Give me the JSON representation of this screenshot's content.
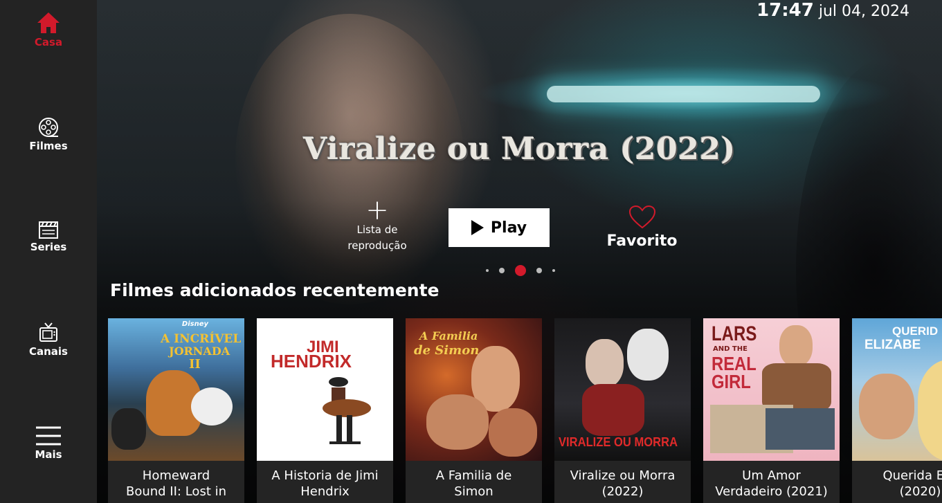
{
  "sidebar": {
    "items": [
      {
        "label": "Casa",
        "icon": "home-icon",
        "active": true
      },
      {
        "label": "Filmes",
        "icon": "film-reel-icon"
      },
      {
        "label": "Series",
        "icon": "clapperboard-icon"
      },
      {
        "label": "Canais",
        "icon": "tv-icon"
      },
      {
        "label": "Mais",
        "icon": "menu-icon"
      }
    ],
    "accent_color": "#d21a2b"
  },
  "header": {
    "time": "17:47",
    "date": "jul 04, 2024"
  },
  "hero": {
    "title": "Viralize ou Morra (2022)",
    "add_label_line1": "Lista de",
    "add_label_line2": "reprodução",
    "play_label": "Play",
    "favorite_label": "Favorito",
    "carousel": {
      "total": 5,
      "active_index": 2
    }
  },
  "section": {
    "title": "Filmes adicionados recentemente"
  },
  "movies": [
    {
      "caption_line1": "Homeward",
      "caption_line2": "Bound II: Lost in",
      "poster_text1": "Disney",
      "poster_text2": "A INCRÍVEL",
      "poster_text3": "JORNADA",
      "poster_text4": "II"
    },
    {
      "caption_line1": "A Historia de Jimi",
      "caption_line2": "Hendrix",
      "poster_text1": "JIMI",
      "poster_text2": "HENDRIX"
    },
    {
      "caption_line1": "A Familia de",
      "caption_line2": "Simon",
      "poster_text1": "A Familia",
      "poster_text2": "de Simon"
    },
    {
      "caption_line1": "Viralize ou Morra",
      "caption_line2": "(2022)",
      "poster_text1": "VIRALIZE OU MORRA"
    },
    {
      "caption_line1": "Um Amor",
      "caption_line2": "Verdadeiro (2021)",
      "poster_text1": "LARS",
      "poster_text2": "AND THE",
      "poster_text3": "REAL",
      "poster_text4": "GIRL"
    },
    {
      "caption_line1": "Querida Eliz",
      "caption_line2": "(2020)",
      "poster_text1": "QUERID",
      "poster_text2": "ELIZABE"
    }
  ]
}
